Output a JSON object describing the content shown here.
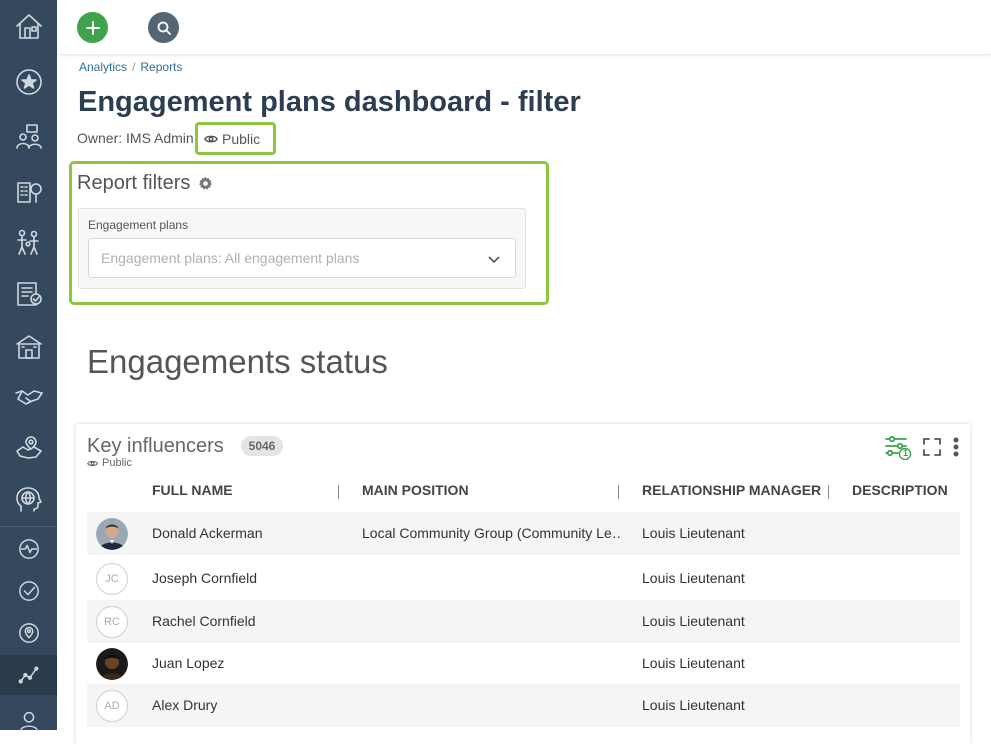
{
  "topbar": {
    "add_icon": "plus-icon",
    "search_icon": "search-icon"
  },
  "sidebar": {
    "items": [
      {
        "name": "home-icon"
      },
      {
        "name": "star-icon"
      },
      {
        "name": "people-chat-icon"
      },
      {
        "name": "building-tree-icon"
      },
      {
        "name": "family-icon"
      },
      {
        "name": "checklist-icon"
      },
      {
        "name": "school-icon"
      },
      {
        "name": "handshake-icon"
      },
      {
        "name": "map-pin-icon"
      },
      {
        "name": "globe-head-icon"
      },
      {
        "name": "pulse-icon"
      },
      {
        "name": "check-circle-icon"
      },
      {
        "name": "location-icon"
      },
      {
        "name": "analytics-icon",
        "active": true
      },
      {
        "name": "user-icon"
      }
    ]
  },
  "breadcrumb": {
    "items": [
      "Analytics",
      "Reports"
    ],
    "separator": "/"
  },
  "page": {
    "title": "Engagement plans dashboard - filter",
    "owner": "Owner: IMS Admin",
    "visibility": "Public"
  },
  "filters": {
    "title": "Report filters",
    "label": "Engagement plans",
    "placeholder": "Engagement plans: All engagement plans"
  },
  "section": {
    "title": "Engagements status"
  },
  "card": {
    "title": "Key influencers",
    "count": "5046",
    "visibility": "Public",
    "filter_count": "1",
    "columns": [
      "FULL NAME",
      "MAIN POSITION",
      "RELATIONSHIP MANAGER",
      "DESCRIPTION"
    ],
    "rows": [
      {
        "avatar": "photo",
        "initials": "",
        "name": "Donald Ackerman",
        "position": "Local Community Group (Community Le…",
        "manager": "Louis Lieutenant",
        "description": ""
      },
      {
        "avatar": "initials",
        "initials": "JC",
        "name": "Joseph Cornfield",
        "position": "",
        "manager": "Louis Lieutenant",
        "description": ""
      },
      {
        "avatar": "initials",
        "initials": "RC",
        "name": "Rachel Cornfield",
        "position": "",
        "manager": "Louis Lieutenant",
        "description": ""
      },
      {
        "avatar": "photo",
        "initials": "",
        "name": "Juan Lopez",
        "position": "",
        "manager": "Louis Lieutenant",
        "description": ""
      },
      {
        "avatar": "initials",
        "initials": "AD",
        "name": "Alex Drury",
        "position": "",
        "manager": "Louis Lieutenant",
        "description": ""
      }
    ]
  },
  "colors": {
    "accent_green": "#8dc63f",
    "sidebar_bg": "#34495e",
    "add_green": "#3fa34d"
  }
}
